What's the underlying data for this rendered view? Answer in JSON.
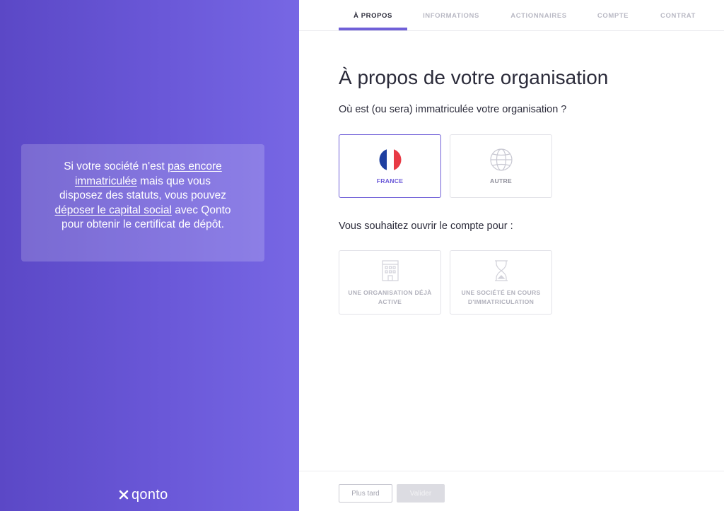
{
  "sidebar": {
    "info_parts": [
      "Si votre société n'est ",
      "pas encore immatriculée",
      " mais que vous disposez des statuts, vous pouvez ",
      "déposer le capital social",
      " avec Qonto pour obtenir le certificat de dépôt."
    ],
    "logo_text": "qonto"
  },
  "nav": {
    "tabs": [
      {
        "label": "À PROPOS",
        "active": true
      },
      {
        "label": "INFORMATIONS",
        "active": false
      },
      {
        "label": "ACTIONNAIRES",
        "active": false
      },
      {
        "label": "COMPTE",
        "active": false
      },
      {
        "label": "CONTRAT",
        "active": false
      }
    ]
  },
  "main": {
    "title": "À propos de votre organisation",
    "question_registration": "Où est (ou sera) immatriculée votre organisation ?",
    "registration_options": [
      {
        "label": "FRANCE",
        "icon": "france-flag-icon",
        "selected": true
      },
      {
        "label": "AUTRE",
        "icon": "globe-icon",
        "selected": false
      }
    ],
    "question_purpose": "Vous souhaitez ouvrir le compte pour :",
    "purpose_options": [
      {
        "label": "UNE ORGANISATION DÉJÀ ACTIVE",
        "icon": "building-icon"
      },
      {
        "label": "UNE SOCIÉTÉ EN COURS D'IMMATRICULATION",
        "icon": "hourglass-icon"
      }
    ]
  },
  "footer": {
    "later_label": "Plus tard",
    "validate_label": "Valider"
  },
  "colors": {
    "accent": "#7060d8",
    "gradient_start": "#5b48c6",
    "gradient_end": "#7767e4",
    "flag_blue": "#1e3fa0",
    "flag_red": "#e83a45"
  }
}
